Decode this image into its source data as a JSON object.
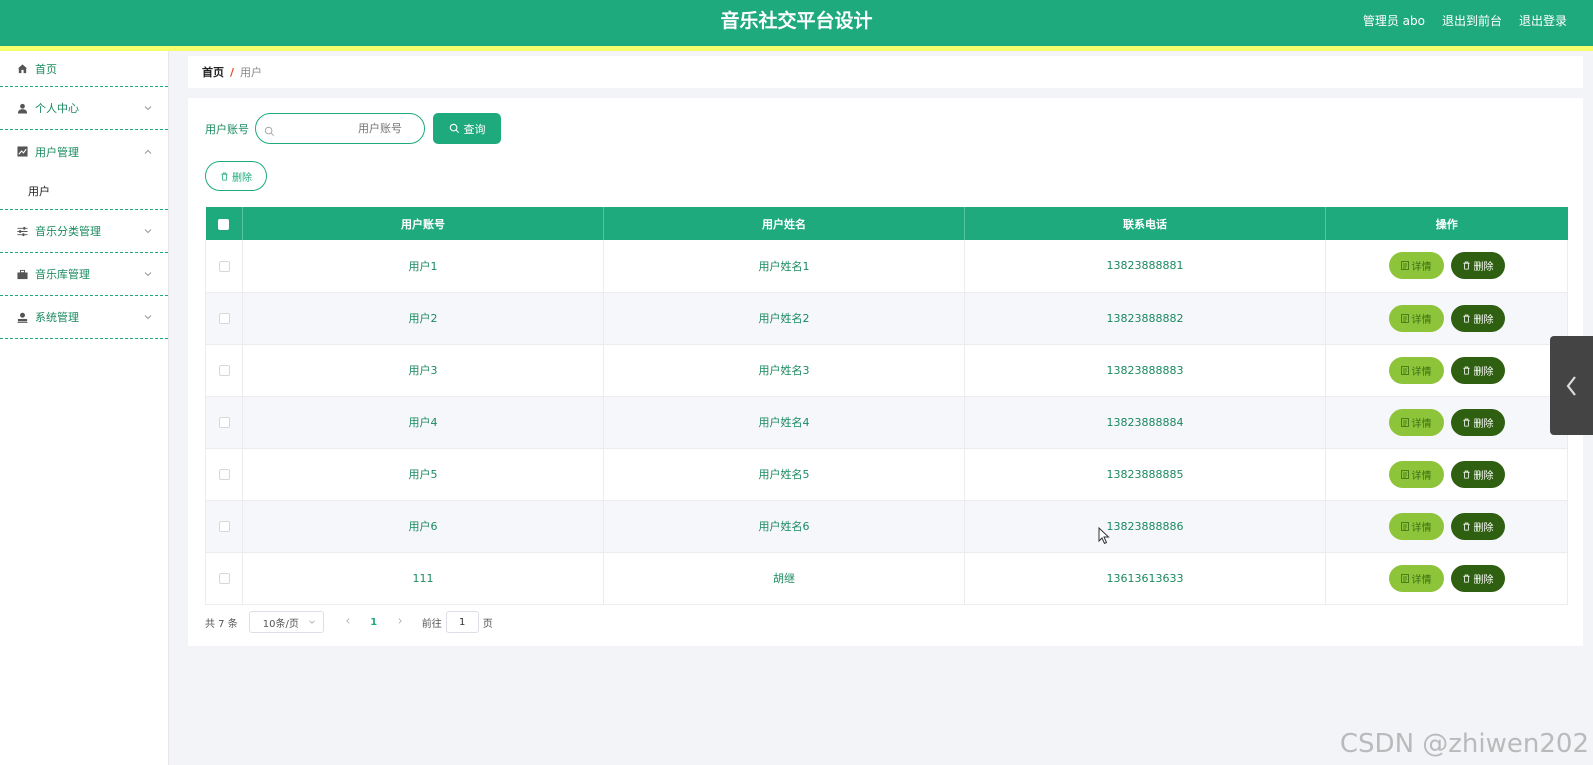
{
  "header": {
    "title": "音乐社交平台设计",
    "user_label": "管理员 abo",
    "to_front": "退出到前台",
    "logout": "退出登录"
  },
  "sidebar": {
    "items": [
      {
        "label": "首页",
        "icon": "home-icon"
      },
      {
        "label": "个人中心",
        "icon": "user-icon"
      },
      {
        "label": "用户管理",
        "icon": "chart-icon",
        "open": true,
        "children": [
          {
            "label": "用户"
          }
        ]
      },
      {
        "label": "音乐分类管理",
        "icon": "sliders-icon"
      },
      {
        "label": "音乐库管理",
        "icon": "briefcase-icon"
      },
      {
        "label": "系统管理",
        "icon": "person-icon"
      }
    ]
  },
  "breadcrumb": {
    "home": "首页",
    "separator": "/",
    "current": "用户"
  },
  "search": {
    "label": "用户账号",
    "placeholder": "用户账号",
    "query_button": "查询"
  },
  "toolbar": {
    "delete_label": "删除"
  },
  "table": {
    "columns": [
      "用户账号",
      "用户姓名",
      "联系电话",
      "操作"
    ],
    "rows": [
      {
        "account": "用户1",
        "name": "用户姓名1",
        "phone": "13823888881"
      },
      {
        "account": "用户2",
        "name": "用户姓名2",
        "phone": "13823888882"
      },
      {
        "account": "用户3",
        "name": "用户姓名3",
        "phone": "13823888883"
      },
      {
        "account": "用户4",
        "name": "用户姓名4",
        "phone": "13823888884"
      },
      {
        "account": "用户5",
        "name": "用户姓名5",
        "phone": "13823888885"
      },
      {
        "account": "用户6",
        "name": "用户姓名6",
        "phone": "13823888886"
      },
      {
        "account": "111",
        "name": "胡继",
        "phone": "13613613633"
      }
    ],
    "detail_label": "详情",
    "delete_label": "删除"
  },
  "pagination": {
    "total": "共 7 条",
    "page_size": "10条/页",
    "current_page": "1",
    "goto_label": "前往",
    "goto_value": "1",
    "page_suffix": "页"
  },
  "watermark": "CSDN @zhiwen202",
  "colors": {
    "primary": "#1faa7d",
    "stripe": "#f6ff6b",
    "detail": "#8ec43a",
    "delete": "#2f5f10"
  }
}
